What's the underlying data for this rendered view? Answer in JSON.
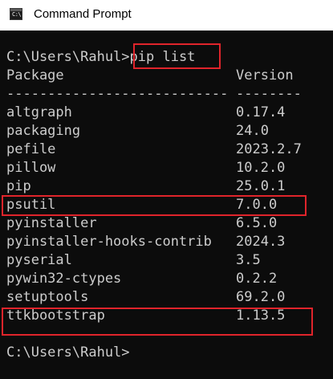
{
  "window": {
    "title": "Command Prompt",
    "icon": "cmd-app-icon",
    "icon_glyph": "C:\\"
  },
  "console": {
    "command_prompt": "C:\\Users\\Rahul>",
    "command": "pip list",
    "header": {
      "package": "Package",
      "version": "Version",
      "package_rule": "---------------------------",
      "version_rule": "--------"
    },
    "packages": [
      {
        "name": "altgraph",
        "version": "0.17.4"
      },
      {
        "name": "packaging",
        "version": "24.0"
      },
      {
        "name": "pefile",
        "version": "2023.2.7"
      },
      {
        "name": "pillow",
        "version": "10.2.0"
      },
      {
        "name": "pip",
        "version": "25.0.1"
      },
      {
        "name": "psutil",
        "version": "7.0.0"
      },
      {
        "name": "pyinstaller",
        "version": "6.5.0"
      },
      {
        "name": "pyinstaller-hooks-contrib",
        "version": "2024.3"
      },
      {
        "name": "pyserial",
        "version": "3.5"
      },
      {
        "name": "pywin32-ctypes",
        "version": "0.2.2"
      },
      {
        "name": "setuptools",
        "version": "69.2.0"
      },
      {
        "name": "ttkbootstrap",
        "version": "1.13.5"
      }
    ],
    "final_prompt": "C:\\Users\\Rahul>"
  },
  "colors": {
    "background": "#0c0c0c",
    "text": "#cccccc",
    "highlight": "#e0242b",
    "titlebar": "#ffffff"
  }
}
